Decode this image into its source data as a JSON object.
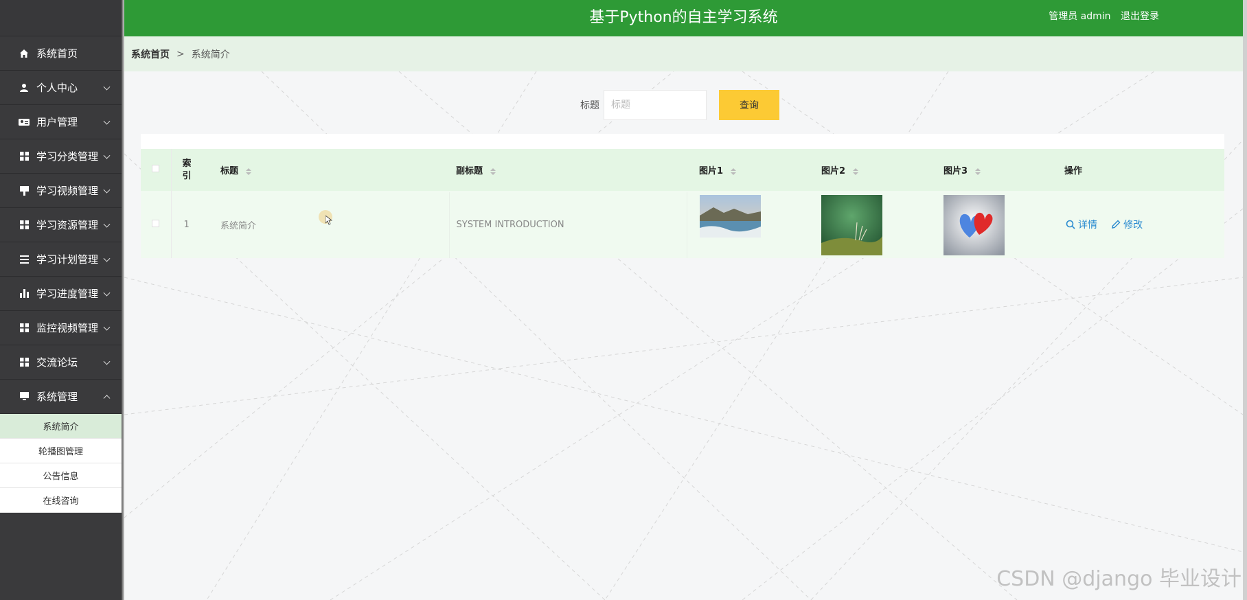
{
  "header": {
    "title": "基于Python的自主学习系统",
    "user_label": "管理员 admin",
    "logout_label": "退出登录"
  },
  "sidebar": {
    "items": [
      {
        "label": "系统首页",
        "icon": "home-icon"
      },
      {
        "label": "个人中心",
        "icon": "user-icon"
      },
      {
        "label": "用户管理",
        "icon": "id-card-icon"
      },
      {
        "label": "学习分类管理",
        "icon": "grid-icon"
      },
      {
        "label": "学习视频管理",
        "icon": "video-icon"
      },
      {
        "label": "学习资源管理",
        "icon": "grid-icon"
      },
      {
        "label": "学习计划管理",
        "icon": "list-icon"
      },
      {
        "label": "学习进度管理",
        "icon": "bar-chart-icon"
      },
      {
        "label": "监控视频管理",
        "icon": "grid-icon"
      },
      {
        "label": "交流论坛",
        "icon": "grid-icon"
      },
      {
        "label": "系统管理",
        "icon": "monitor-icon"
      }
    ],
    "submenu": [
      {
        "label": "系统简介",
        "active": true
      },
      {
        "label": "轮播图管理",
        "active": false
      },
      {
        "label": "公告信息",
        "active": false
      },
      {
        "label": "在线咨询",
        "active": false
      }
    ]
  },
  "breadcrumb": {
    "home": "系统首页",
    "separator": ">",
    "current": "系统简介"
  },
  "search": {
    "label": "标题",
    "placeholder": "标题",
    "button_label": "查询"
  },
  "table": {
    "columns": {
      "index": "索引",
      "title": "标题",
      "subtitle": "副标题",
      "pic1": "图片1",
      "pic2": "图片2",
      "pic3": "图片3",
      "actions": "操作"
    },
    "rows": [
      {
        "index": "1",
        "title": "系统简介",
        "subtitle": "SYSTEM INTRODUCTION",
        "detail_label": "详情",
        "edit_label": "修改"
      }
    ]
  },
  "watermark": "CSDN @django 毕业设计",
  "colors": {
    "header_bg": "#2e9a36",
    "sidebar_bg": "#3a3a3c",
    "breadcrumb_bg": "#e6f2e6",
    "search_button_bg": "#fcca34",
    "table_header_bg": "#e4f6e4",
    "link_color": "#2a8bd0"
  }
}
